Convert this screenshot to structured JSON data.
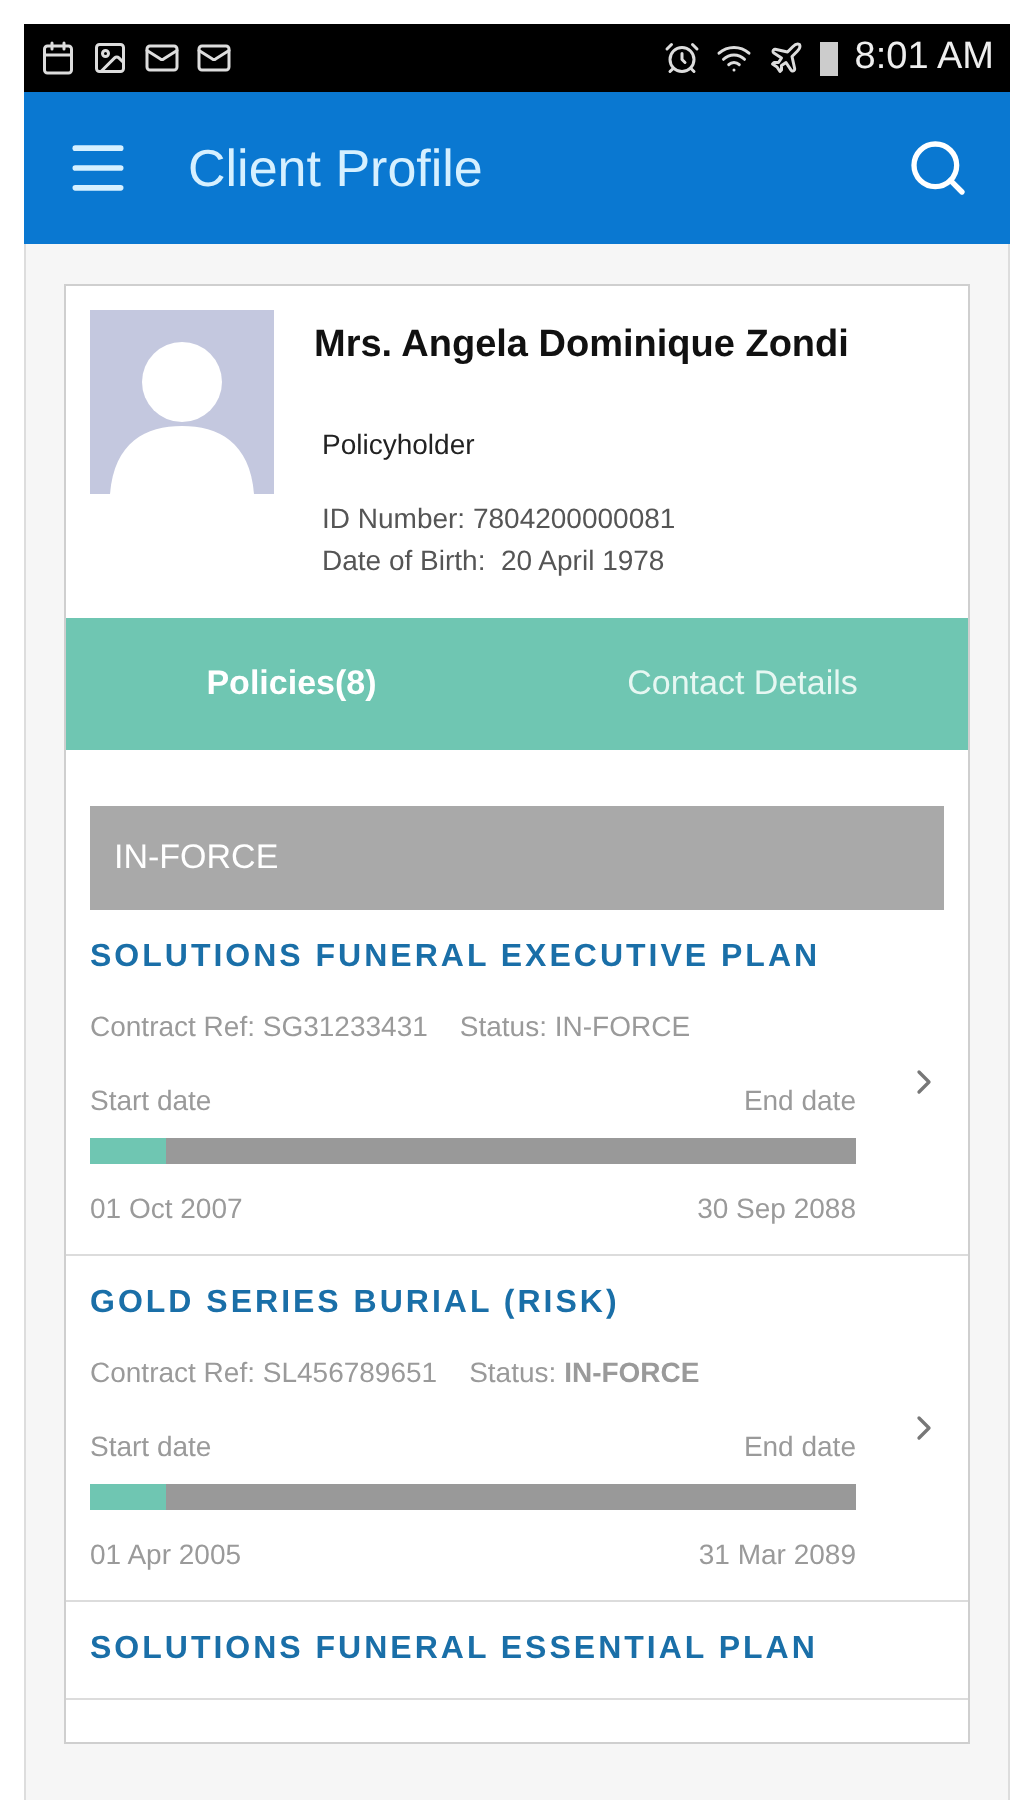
{
  "status_bar": {
    "time": "8:01 AM"
  },
  "app_bar": {
    "title": "Client Profile"
  },
  "profile": {
    "name": "Mrs. Angela Dominique Zondi",
    "role": "Policyholder",
    "id_number": "ID Number: 7804200000081",
    "date_of_birth": "Date of Birth:  20 April 1978"
  },
  "tabs": [
    {
      "label": "Policies(8)",
      "selected": true
    },
    {
      "label": "Contact Details",
      "selected": false
    }
  ],
  "section": {
    "title": "IN-FORCE"
  },
  "policies": [
    {
      "name": "SOLUTIONS FUNERAL EXECUTIVE PLAN",
      "contract_label": "Contract Ref:",
      "contract_ref": "SG31233431",
      "status_label": "Status:",
      "status": "IN-FORCE",
      "start_label": "Start date",
      "end_label": "End date",
      "level": 0.1,
      "start_date": "01 Oct 2007",
      "end_date": "30 Sep 2088"
    },
    {
      "name": "GOLD SERIES BURIAL (RISK)",
      "contract_label": "Contract Ref:",
      "contract_ref": "SL456789651",
      "status_label": "Status:",
      "status": "IN-FORCE",
      "start_label": "Start date",
      "end_label": "End date",
      "level": 0.1,
      "start_date": "01 Apr 2005",
      "end_date": "31 Mar 2089"
    },
    {
      "name": "SOLUTIONS FUNERAL ESSENTIAL PLAN"
    }
  ]
}
